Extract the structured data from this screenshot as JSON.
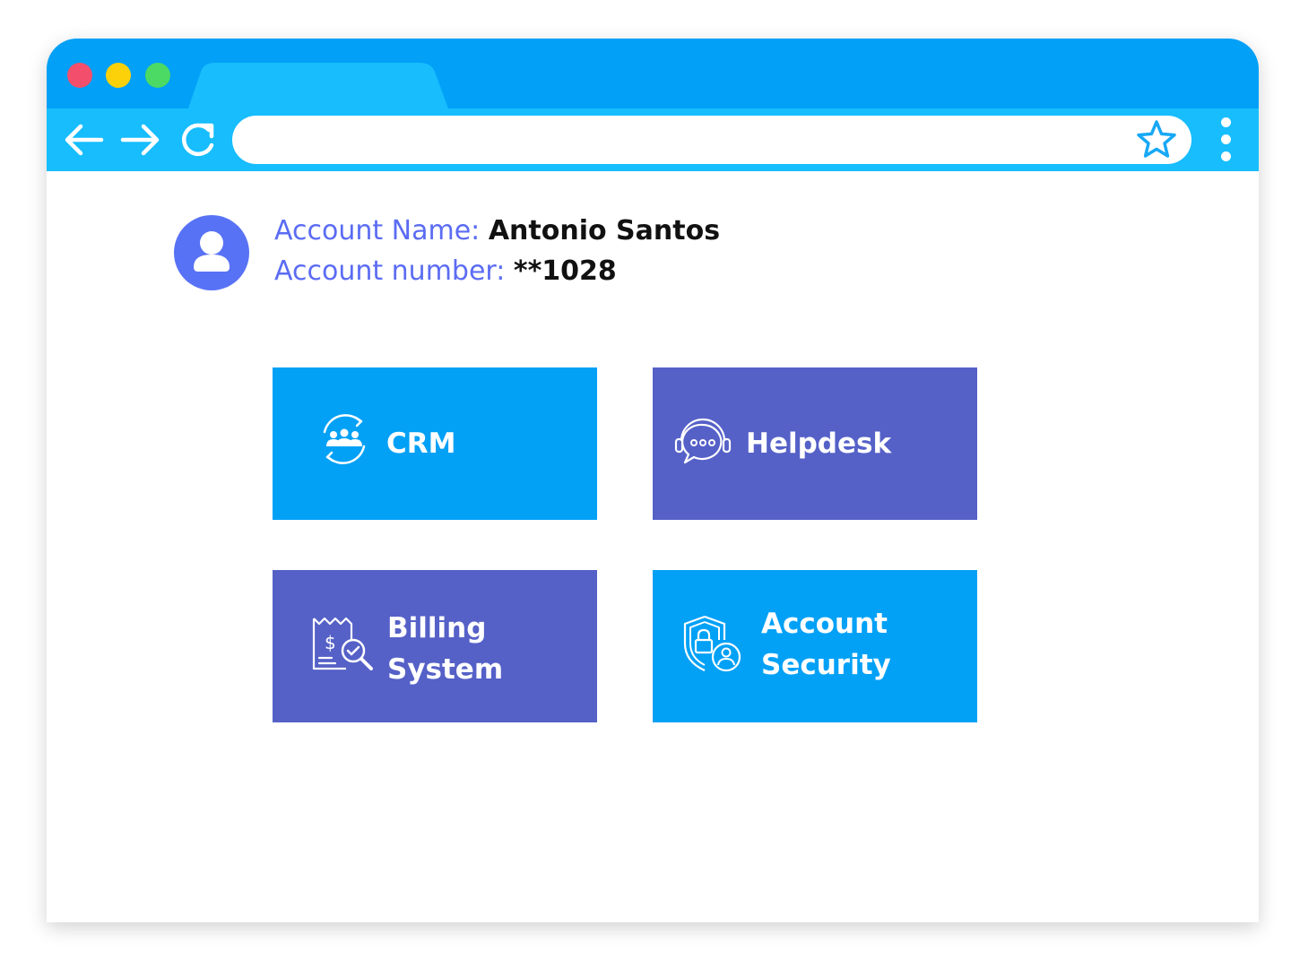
{
  "window": {
    "traffic_lights": [
      {
        "name": "close",
        "color": "#f34f6c"
      },
      {
        "name": "minimize",
        "color": "#fcd10a"
      },
      {
        "name": "maximize",
        "color": "#4cd964"
      }
    ],
    "tab_color": "#17bdfd",
    "titlebar_color": "#02a0f6"
  },
  "toolbar": {
    "back_icon": "arrow-left-icon",
    "forward_icon": "arrow-right-icon",
    "reload_icon": "reload-icon",
    "address_value": "",
    "bookmark_icon": "star-icon",
    "menu_icon": "kebab-menu-icon"
  },
  "account": {
    "avatar_icon": "user-icon",
    "name_label": "Account Name:",
    "name_value": "Antonio Santos",
    "number_label": "Account number:",
    "number_value": "**1028"
  },
  "tiles": [
    {
      "label": "CRM",
      "icon": "crm-people-icon",
      "color": "#03a1f6"
    },
    {
      "label": "Helpdesk",
      "icon": "headset-chat-icon",
      "color": "#5561c7"
    },
    {
      "label_lines": [
        "Billing",
        "System"
      ],
      "icon": "invoice-search-icon",
      "color": "#5561c7"
    },
    {
      "label_lines": [
        "Account",
        "Security"
      ],
      "icon": "shield-lock-user-icon",
      "color": "#03a1f6"
    }
  ]
}
